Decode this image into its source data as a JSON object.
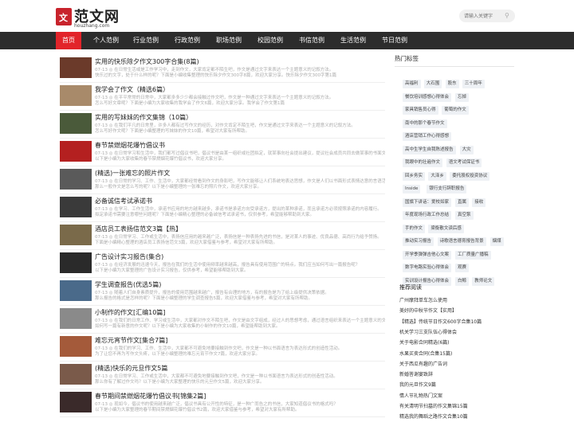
{
  "site": {
    "logo_cn": "范文网",
    "logo_en": "houzhang.com",
    "logo_mark": "文"
  },
  "search": {
    "placeholder": "请输入关键字"
  },
  "nav": [
    "首页",
    "个人范例",
    "行业范例",
    "行政范例",
    "职场范例",
    "校园范例",
    "书信范例",
    "生活范例",
    "节日范例"
  ],
  "articles": [
    {
      "title": "实用的快乐除夕作文300字合集(8篇)",
      "meta": "07-13  ◎ 在日常生活或是工作学习中，走到作文，大家肯定都不陌生吧，作文是通过文字来表达一个主题意义的记叙方法。",
      "desc": "快乐过的文字，处于什么样的呢？下面是小编收集整理的快乐除夕作文300字8篇，欢迎大家分享。快乐除夕作文300字第1篇"
    },
    {
      "title": "我学会了作文（精选6篇）",
      "meta": "07-13  ◎ 在平平常常的日常中，大家都多多少少都会接触过作文吧，作文是一种通过文字来表达一个主题意义的记叙方法。",
      "desc": "怎么写好文章呢？下面是小编为大家收集的我学会了作文6篇，欢迎大家分享。我学会了作文第1篇"
    },
    {
      "title": "实用的写妹妹的作文集锦（10篇）",
      "meta": "07-13  ◎ 在我们平凡的日常里，许多人都有过写作文的经历，对作文肯定不陌生吧，作文是通过文字来表达一个主题意义的记叙方法。",
      "desc": "怎么写好作文呢？下面是小编整理的写妹妹的作文10篇，希望对大家有所帮助。"
    },
    {
      "title": "春节禁燃烟花爆竹倡议书",
      "meta": "07-13  ◎ 在日常学习和生活中，我们都写过倡议书吧，倡议书是由某一组织或社团拟定，就某事向社会提出建议，提议社会成员共同去做某事的书面文章。",
      "desc": "以下是小编为大家收集的春节禁燃烟花爆竹倡议书，欢迎大家分享。"
    },
    {
      "title": "(精选)一张难忘的照片作文",
      "meta": "07-13  ◎ 在日常的学习、工作、生活中，大家都经常看到作文的身影吧，写作文能够让人们系统地表达思想，作文是人们以书面形式表情达意的言语活动。",
      "desc": "那么一般作文是怎么写的呢？以下是小编整理的一张难忘的照片作文，欢迎大家分享。"
    },
    {
      "title": "必备诚信考试承诺书",
      "meta": "07-13  ◎ 在学习、工作生活中，承诺书应用的地方越来越多，承诺书是承诺方向受承诺方，提出的某种承诺，而且承诺方必须按照承诺的内容履行。",
      "desc": "拟定承诺书需要注意哪些问题呢？下面是小编精心整理的必备诚信考试承诺书，仅供参考，希望能够帮助到大家。"
    },
    {
      "title": "酒店员工表扬信范文3篇【热】",
      "meta": "07-13  ◎ 在日常学习、工作或生活中，表扬信应用的越来越广泛，表扬信是一种表扬先进的书信，是对某人的事迹、优良品德、高尚行为给予赞扬。",
      "desc": "下面是小编精心整理的酒店员工表扬信范文3篇，欢迎大家借鉴与参考，希望对大家有所帮助。"
    },
    {
      "title": "广告设计实习报告(集合)",
      "meta": "07-13  ◎ 在经济发展的迅速今天，报告在我们的生活中使用频率越来越高，报告具有使用范围广的特点。我们应当如何写出一篇报告呢？",
      "desc": "以下是小编为大家整理的广告设计实习报告，仅供参考，希望能够帮助到大家。"
    },
    {
      "title": "学生调查报告(优选5篇)",
      "meta": "07-13  ◎ 随着人们自身素质提升，报告的使用范围越来越广，报告有合理的地方，有的报告是为了给上级提供决策依据。",
      "desc": "那么报告的格式是怎样的呢？下面是小编整理的学生调查报告5篇，欢迎大家借鉴与参考，希望对大家有所帮助。"
    },
    {
      "title": "小制作的作文[汇编10篇]",
      "meta": "07-13  ◎ 在我们的日常工作、学习或生活中，大家都对作文不陌生吧，作文是由文字组成，经过人的思想考虑，通过语言组织来表达一个主题意义的文体。",
      "desc": "如何写一篇有新意的作文呢？以下是小编为大家收集的小制作的作文10篇，希望能帮助到大家。"
    },
    {
      "title": "难忘元宵节作文[集合7篇]",
      "meta": "07-13  ◎ 在我们的学习、工作、生活中，大家都不可避免地要接触到作文吧，作文是一种以书面语言为表达形式的创造性活动。",
      "desc": "为了让您不再为写作文头疼，以下是小编整理的难忘元宵节作文7篇，欢迎大家分享。"
    },
    {
      "title": "(精选)快乐的元旦作文5篇",
      "meta": "07-13  ◎ 在日常学习、工作或生活中，大家都不可避免地要接触到作文吧，作文是一种以书面语言为表达形式的创造性活动。",
      "desc": "那么你有了解过作文吗？以下是小编为大家整理的快乐的元旦作文5篇，欢迎大家分享。"
    },
    {
      "title": "春节期间禁燃烟花爆竹倡议书[锦集2篇]",
      "meta": "07-13  ◎ 现如今，倡议书的使用越来越广泛，倡议书具有公开性的特征，是一种广而告之的书信，大家知道倡议书的格式吗？",
      "desc": "以下是小编为大家整理的春节期间禁燃烟花爆竹倡议书2篇，欢迎大家借鉴与参考，希望对大家有所帮助。"
    }
  ],
  "hot_tags": {
    "title": "热门标签",
    "items": [
      "高福利",
      "大石围",
      "股东",
      "三十周年",
      "餐饮培训感想心得体会",
      "忘掉",
      "家具销售员心得",
      "葡萄的作文",
      "南中的那个春节作文",
      "酒店营销工作心得感想",
      "高中生学生自我陈述报告",
      "大灾",
      "我眼中的壮遍作文",
      "语文考试保证书",
      "回乡务实",
      "大泽乡",
      "委托股权投资协议",
      "Inside",
      "银行支行辞职报告",
      "国旗下讲话：爱校如家",
      "直属",
      "接收",
      "年度现场行政工作总结",
      "真空泵",
      "手的作文",
      "梁衡散文读后感",
      "推动实习报告",
      "诗歌语言德育报告背景",
      "烟煤",
      "开学季弹弹吉他心文案",
      "工厂质量广播稿",
      "数字电路实验心得体会",
      "观赛",
      "实训设计报告心得体会",
      "白鲸",
      "教师论文"
    ]
  },
  "recommended": {
    "title": "推荐阅读",
    "items": [
      "广州摩拜单车怎么使用",
      "美好的中秋节作文【实用】",
      "【精选】传统节日作文600字合集10篇",
      "机关学习三支队伍心得体会",
      "关于电影合同精选(6篇)",
      "水果买卖合同(合集15篇)",
      "关于西瓜有趣的广告词",
      "新婚答谢宴致辞",
      "我的元旦作文9篇",
      "情人节礼物热门文案",
      "有关清明节扫墓的作文集锦15篇",
      "精选我的舞蹈之路作文合集10篇"
    ]
  }
}
